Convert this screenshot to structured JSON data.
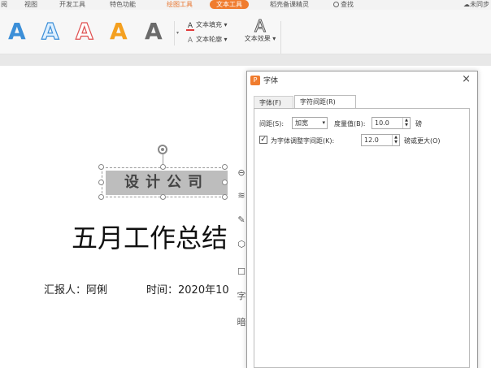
{
  "ribbon_tabs": [
    {
      "label": "阅"
    },
    {
      "label": "视图"
    },
    {
      "label": "开发工具"
    },
    {
      "label": "特色功能"
    },
    {
      "label": "绘图工具"
    },
    {
      "label": "文本工具"
    },
    {
      "label": "稻壳备课精灵"
    }
  ],
  "search_label": "查找",
  "sync_label": "未同步",
  "text_styles": [
    "A",
    "A",
    "A",
    "A",
    "A"
  ],
  "text_fill_label": "文本填充",
  "text_outline_label": "文本轮廓",
  "text_effect_label": "文本效果",
  "text_effect_glyph": "A",
  "slide": {
    "textbox_text": "设计公司",
    "title": "五月工作总结",
    "reporter": "汇报人：阿俐",
    "time": "时间：2020年10"
  },
  "float_tools": [
    "≋",
    "✎",
    "⬡",
    "☐",
    "字",
    "暗"
  ],
  "dialog": {
    "title": "字体",
    "close": "×",
    "logo": "P",
    "tabs": [
      "字体(F)",
      "字符间距(R)"
    ],
    "spacing_label": "间距(S):",
    "spacing_value": "加宽",
    "degree_label": "度量值(B):",
    "degree_value": "10.0",
    "degree_unit": "磅",
    "kerning_checked": true,
    "kerning_label": "为字体调整字间距(K):",
    "kerning_value": "12.0",
    "kerning_suffix": "磅或更大(O)"
  }
}
